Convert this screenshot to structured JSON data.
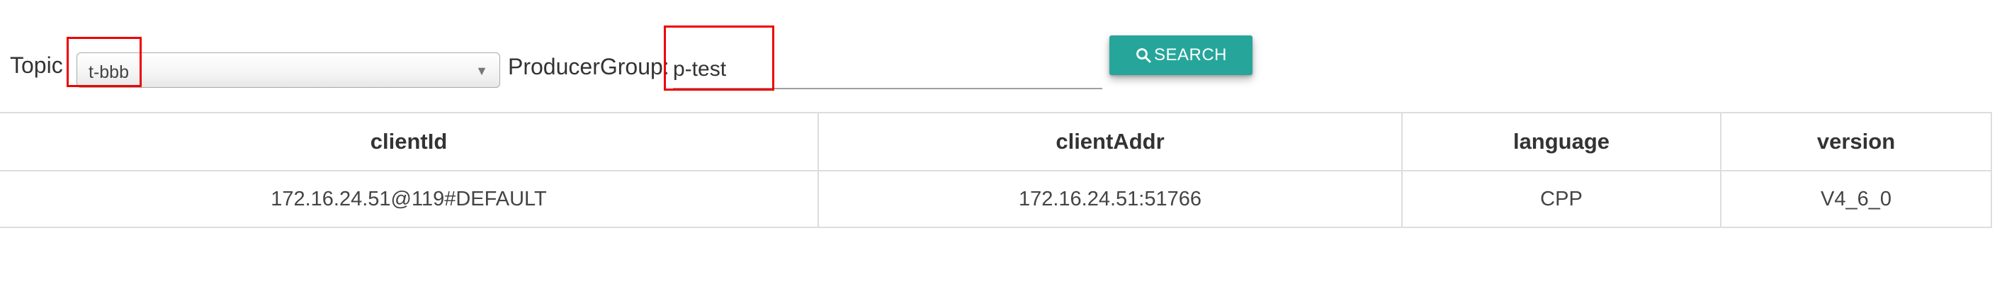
{
  "filters": {
    "topic_label": "Topic",
    "topic_value": "t-bbb",
    "producer_group_label": "ProducerGroup:",
    "producer_group_value": "p-test",
    "search_button_label": "SEARCH"
  },
  "table": {
    "columns": [
      "clientId",
      "clientAddr",
      "language",
      "version"
    ],
    "rows": [
      [
        "172.16.24.51@119#DEFAULT",
        "172.16.24.51:51766",
        "CPP",
        "V4_6_0"
      ]
    ]
  },
  "colors": {
    "accent": "#26a69a",
    "highlight": "#ee0000",
    "border": "#dddddd"
  },
  "icons": {
    "search": "search-icon",
    "dropdown": "chevron-down-icon"
  }
}
